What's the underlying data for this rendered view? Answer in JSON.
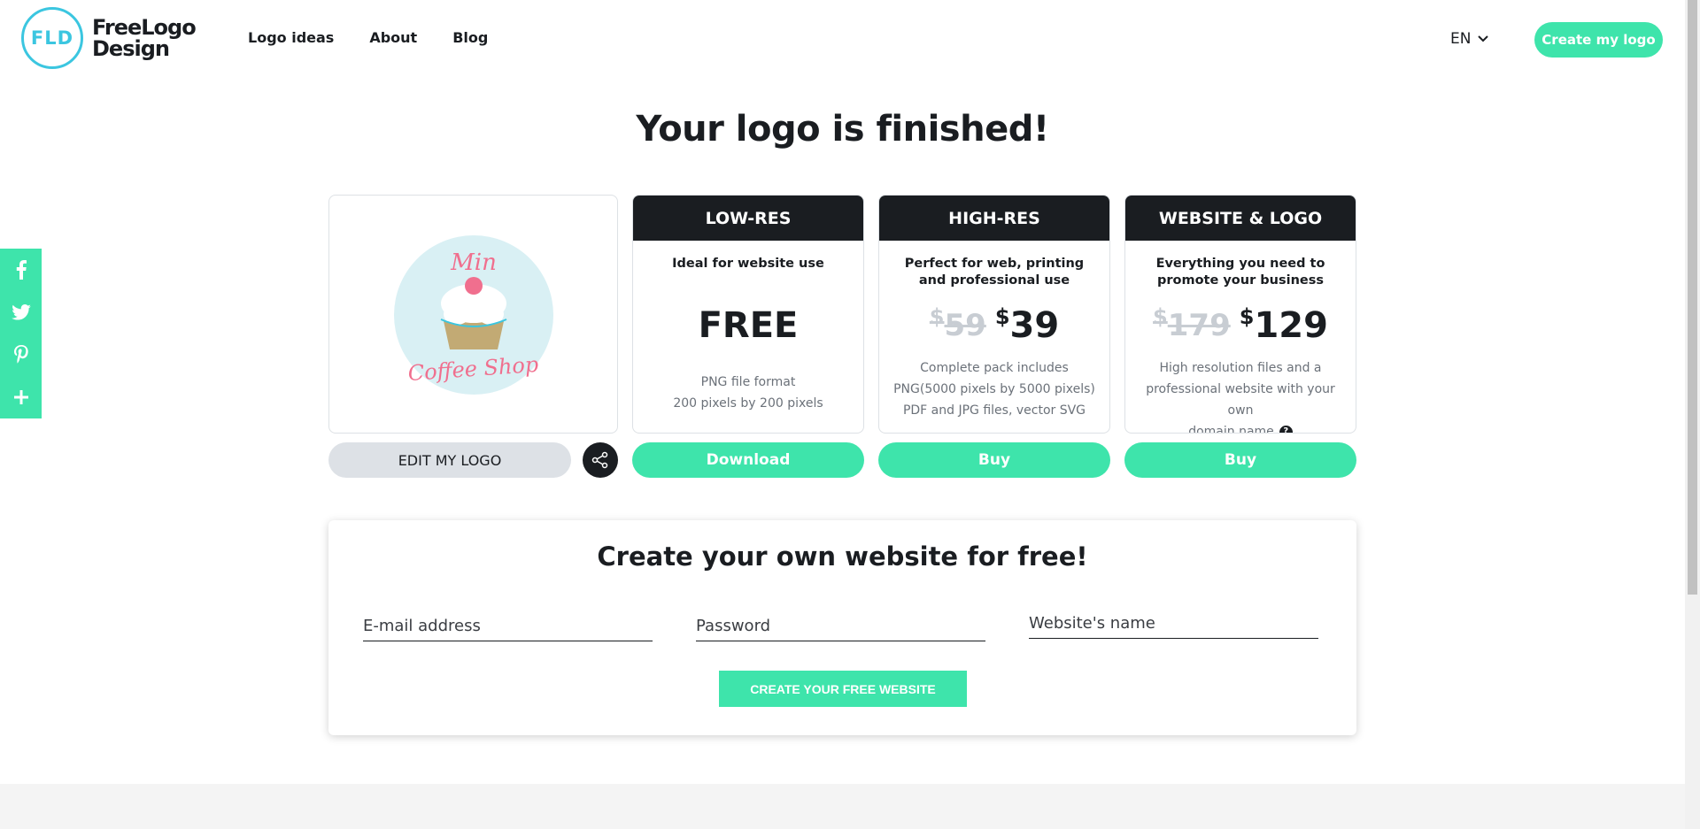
{
  "header": {
    "logo_mark": "FLD",
    "logo_line1": "FreeLogo",
    "logo_line2": "Design",
    "nav": [
      "Logo ideas",
      "About",
      "Blog"
    ],
    "lang": "EN",
    "cta": "Create my logo"
  },
  "social": [
    "facebook-icon",
    "twitter-icon",
    "pinterest-icon",
    "plus-icon"
  ],
  "page_title": "Your logo is finished!",
  "preview": {
    "logo_top_text": "Min",
    "logo_bottom_text": "Coffee Shop",
    "edit_label": "EDIT MY LOGO"
  },
  "plans": [
    {
      "name": "LOW-RES",
      "subtitle": "Ideal for website use",
      "price": "FREE",
      "desc_lines": [
        "PNG file format",
        "200 pixels by 200 pixels"
      ],
      "button": "Download"
    },
    {
      "name": "HIGH-RES",
      "subtitle": "Perfect for web, printing and professional use",
      "old_price": "59",
      "new_price": "39",
      "currency": "$",
      "desc_lines": [
        "Complete pack includes",
        "PNG(5000 pixels by 5000 pixels)",
        "PDF and JPG files, vector SVG"
      ],
      "button": "Buy"
    },
    {
      "name": "WEBSITE & LOGO",
      "subtitle": "Everything you need to promote your business",
      "old_price": "179",
      "new_price": "129",
      "currency": "$",
      "desc_lines": [
        "High resolution files and a",
        "professional website with your own",
        "domain name"
      ],
      "help": "?",
      "button": "Buy"
    }
  ],
  "website_form": {
    "title": "Create your own website for free!",
    "email_placeholder": "E-mail address",
    "password_placeholder": "Password",
    "site_name_placeholder": "Website's name",
    "submit": "CREATE YOUR FREE WEBSITE"
  },
  "colors": {
    "accent": "#3ee4ab",
    "dark": "#1a1d21",
    "logo_blue": "#3bc6e0",
    "logo_pink": "#f06f8e",
    "logo_bg": "#d9f0f4"
  }
}
